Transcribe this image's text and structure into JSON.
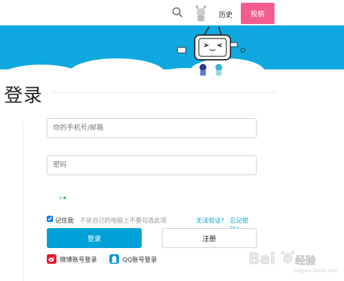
{
  "header": {
    "history_label": "历史",
    "post_label": "投稿"
  },
  "page": {
    "title": "登录"
  },
  "form": {
    "username_placeholder": "你的手机号/邮箱",
    "password_placeholder": "密码",
    "remember_label": "记住我",
    "remember_hint": "不是自己的电脑上不要勾选此项",
    "remember_checked": true,
    "cant_verify": "无法验证?",
    "forgot_password": "忘记密码?",
    "login_label": "登录",
    "register_label": "注册"
  },
  "social": {
    "weibo_label": "微博账号登录",
    "qq_label": "QQ账号登录"
  },
  "watermark": {
    "brand": "Bai",
    "brand_suffix": "经验",
    "url": "jingyan.baidu.com"
  },
  "colors": {
    "accent": "#00a1d6",
    "post_button": "#f25d8e",
    "banner": "#10a8e0",
    "weibo": "#e6162d",
    "qq": "#1296db"
  },
  "icons": [
    "search-icon",
    "avatar-icon",
    "weibo-icon",
    "qq-icon",
    "tv-mascot-icon"
  ]
}
